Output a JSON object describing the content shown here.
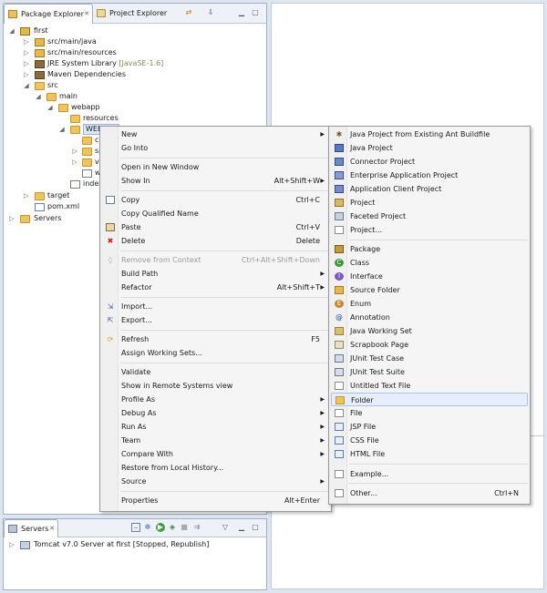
{
  "explorer": {
    "tabs": [
      {
        "label": "Package Explorer",
        "close": "✕"
      },
      {
        "label": "Project Explorer"
      }
    ],
    "tree": [
      {
        "label": "first",
        "icon": "project-icon"
      },
      {
        "label": "src/main/java",
        "icon": "source-folder-icon"
      },
      {
        "label": "src/main/resources",
        "icon": "source-folder-icon"
      },
      {
        "label": "JRE System Library",
        "extra": "[JavaSE-1.6]",
        "icon": "library-icon"
      },
      {
        "label": "Maven Dependencies",
        "icon": "library-icon"
      },
      {
        "label": "src",
        "icon": "folder-icon"
      },
      {
        "label": "main",
        "icon": "folder-icon"
      },
      {
        "label": "webapp",
        "icon": "folder-icon"
      },
      {
        "label": "resources",
        "icon": "folder-icon"
      },
      {
        "label": "WEB-INF",
        "icon": "folder-icon"
      },
      {
        "label": "cl",
        "icon": "folder-icon"
      },
      {
        "label": "sp",
        "icon": "folder-icon"
      },
      {
        "label": "vi",
        "icon": "folder-icon"
      },
      {
        "label": "w",
        "icon": "xml-file-icon"
      },
      {
        "label": "index",
        "icon": "file-icon"
      },
      {
        "label": "target",
        "icon": "folder-icon"
      },
      {
        "label": "pom.xml",
        "icon": "xml-file-icon"
      },
      {
        "label": "Servers",
        "icon": "folder-icon"
      }
    ]
  },
  "servers": {
    "tab_label": "Servers",
    "close": "✕",
    "entry_name": "Tomcat v7.0 Server at first",
    "entry_status": "[Stopped, Republish]"
  },
  "context_menu": {
    "items": [
      {
        "label": "New",
        "submenu": true
      },
      {
        "label": "Go Into"
      },
      {
        "label": "Open in New Window"
      },
      {
        "label": "Show In",
        "shortcut": "Alt+Shift+W",
        "submenu": true
      },
      {
        "label": "Copy",
        "shortcut": "Ctrl+C"
      },
      {
        "label": "Copy Qualified Name"
      },
      {
        "label": "Paste",
        "shortcut": "Ctrl+V"
      },
      {
        "label": "Delete",
        "shortcut": "Delete"
      },
      {
        "label": "Remove from Context",
        "shortcut": "Ctrl+Alt+Shift+Down"
      },
      {
        "label": "Build Path",
        "submenu": true
      },
      {
        "label": "Refactor",
        "shortcut": "Alt+Shift+T",
        "submenu": true
      },
      {
        "label": "Import..."
      },
      {
        "label": "Export..."
      },
      {
        "label": "Refresh",
        "shortcut": "F5"
      },
      {
        "label": "Assign Working Sets..."
      },
      {
        "label": "Validate"
      },
      {
        "label": "Show in Remote Systems view"
      },
      {
        "label": "Profile As",
        "submenu": true
      },
      {
        "label": "Debug As",
        "submenu": true
      },
      {
        "label": "Run As",
        "submenu": true
      },
      {
        "label": "Team",
        "submenu": true
      },
      {
        "label": "Compare With",
        "submenu": true
      },
      {
        "label": "Restore from Local History..."
      },
      {
        "label": "Source",
        "submenu": true
      },
      {
        "label": "Properties",
        "shortcut": "Alt+Enter"
      }
    ],
    "submenu_arrow": "▶"
  },
  "new_submenu": {
    "items": [
      {
        "label": "Java Project from Existing Ant Buildfile"
      },
      {
        "label": "Java Project"
      },
      {
        "label": "Connector Project"
      },
      {
        "label": "Enterprise Application Project"
      },
      {
        "label": "Application Client Project"
      },
      {
        "label": "Project"
      },
      {
        "label": "Faceted Project"
      },
      {
        "label": "Project..."
      },
      {
        "label": "Package"
      },
      {
        "label": "Class"
      },
      {
        "label": "Interface"
      },
      {
        "label": "Source Folder"
      },
      {
        "label": "Enum"
      },
      {
        "label": "Annotation"
      },
      {
        "label": "Java Working Set"
      },
      {
        "label": "Scrapbook Page"
      },
      {
        "label": "JUnit Test Case"
      },
      {
        "label": "JUnit Test Suite"
      },
      {
        "label": "Untitled Text File"
      },
      {
        "label": "Folder"
      },
      {
        "label": "File"
      },
      {
        "label": "JSP File"
      },
      {
        "label": "CSS File"
      },
      {
        "label": "HTML File"
      },
      {
        "label": "Example..."
      },
      {
        "label": "Other...",
        "shortcut": "Ctrl+N"
      }
    ]
  }
}
